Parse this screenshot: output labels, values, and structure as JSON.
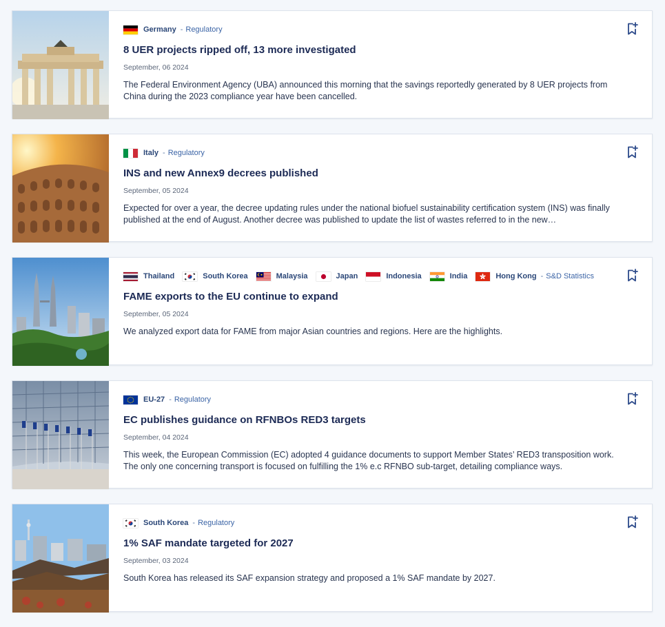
{
  "articles": [
    {
      "image": "brandenburg-gate-photo",
      "countries": [
        {
          "name": "Germany",
          "flag": "germany-flag"
        }
      ],
      "category": "Regulatory",
      "title": "8 UER projects ripped off, 13 more investigated",
      "date": "September, 06 2024",
      "excerpt": "The Federal Environment Agency (UBA) announced this morning that the savings reportedly generated by 8 UER projects from China during the 2023 compliance year have been cancelled."
    },
    {
      "image": "colosseum-photo",
      "countries": [
        {
          "name": "Italy",
          "flag": "italy-flag"
        }
      ],
      "category": "Regulatory",
      "title": "INS and new Annex9 decrees published",
      "date": "September, 05 2024",
      "excerpt": "Expected for over a year, the decree updating rules under the national biofuel sustainability certification system (INS) was finally published at the end of August. Another decree was published to update the list of wastes referred to in the new…"
    },
    {
      "image": "kuala-lumpur-skyline-photo",
      "countries": [
        {
          "name": "Thailand",
          "flag": "thailand-flag"
        },
        {
          "name": "South Korea",
          "flag": "south-korea-flag"
        },
        {
          "name": "Malaysia",
          "flag": "malaysia-flag"
        },
        {
          "name": "Japan",
          "flag": "japan-flag"
        },
        {
          "name": "Indonesia",
          "flag": "indonesia-flag"
        },
        {
          "name": "India",
          "flag": "india-flag"
        },
        {
          "name": "Hong Kong",
          "flag": "hong-kong-flag"
        }
      ],
      "category": "S&D Statistics",
      "title": "FAME exports to the EU continue to expand",
      "date": "September, 05 2024",
      "excerpt": "We analyzed export data for FAME from major Asian countries and regions. Here are the highlights."
    },
    {
      "image": "eu-commission-building-photo",
      "countries": [
        {
          "name": "EU-27",
          "flag": "eu-flag"
        }
      ],
      "category": "Regulatory",
      "title": "EC publishes guidance on RFNBOs RED3 targets",
      "date": "September, 04 2024",
      "excerpt": "This week, the European Commission (EC) adopted 4 guidance documents to support Member States’ RED3 transposition work. The only one concerning transport is focused on fulfilling the 1% e.c RFNBO sub-target, detailing compliance ways."
    },
    {
      "image": "seoul-hanok-photo",
      "countries": [
        {
          "name": "South Korea",
          "flag": "south-korea-flag"
        }
      ],
      "category": "Regulatory",
      "title": "1% SAF mandate targeted for 2027",
      "date": "September, 03 2024",
      "excerpt": "South Korea has released its SAF expansion strategy and proposed a 1% SAF mandate by 2027."
    }
  ],
  "separator": "-",
  "bookmark_icon": "bookmark-add-icon",
  "colors": {
    "title": "#1c2a55",
    "country": "#2b4778",
    "category": "#3b64a6",
    "bookmark": "#2c4a8a"
  }
}
